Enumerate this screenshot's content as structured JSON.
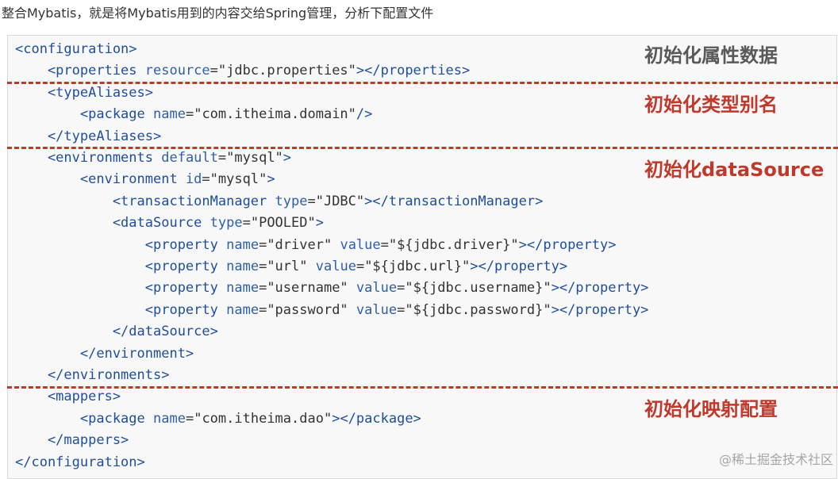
{
  "intro_text": "整合Mybatis，就是将Mybatis用到的内容交给Spring管理，分析下配置文件",
  "colors": {
    "tag": "#1f4e9c",
    "attr": "#2f5fa8",
    "value": "#333333",
    "label_gray": "#595959",
    "label_red": "#c0392b",
    "divider": "#c0392b"
  },
  "code_lines": [
    [
      {
        "t": "tag",
        "s": "<configuration>"
      }
    ],
    [
      {
        "t": "tag",
        "s": "    <properties "
      },
      {
        "t": "attr",
        "s": "resource"
      },
      {
        "t": "plain",
        "s": "="
      },
      {
        "t": "val",
        "s": "\"jdbc.properties\""
      },
      {
        "t": "tag",
        "s": "></properties>"
      }
    ],
    [
      {
        "t": "tag",
        "s": "    <typeAliases>"
      }
    ],
    [
      {
        "t": "tag",
        "s": "        <package "
      },
      {
        "t": "attr",
        "s": "name"
      },
      {
        "t": "plain",
        "s": "="
      },
      {
        "t": "val",
        "s": "\"com.itheima.domain\""
      },
      {
        "t": "tag",
        "s": "/>"
      }
    ],
    [
      {
        "t": "tag",
        "s": "    </typeAliases>"
      }
    ],
    [
      {
        "t": "tag",
        "s": "    <environments "
      },
      {
        "t": "attr",
        "s": "default"
      },
      {
        "t": "plain",
        "s": "="
      },
      {
        "t": "val",
        "s": "\"mysql\""
      },
      {
        "t": "tag",
        "s": ">"
      }
    ],
    [
      {
        "t": "tag",
        "s": "        <environment "
      },
      {
        "t": "attr",
        "s": "id"
      },
      {
        "t": "plain",
        "s": "="
      },
      {
        "t": "val",
        "s": "\"mysql\""
      },
      {
        "t": "tag",
        "s": ">"
      }
    ],
    [
      {
        "t": "tag",
        "s": "            <transactionManager "
      },
      {
        "t": "attr",
        "s": "type"
      },
      {
        "t": "plain",
        "s": "="
      },
      {
        "t": "val",
        "s": "\"JDBC\""
      },
      {
        "t": "tag",
        "s": "></transactionManager>"
      }
    ],
    [
      {
        "t": "tag",
        "s": "            <dataSource "
      },
      {
        "t": "attr",
        "s": "type"
      },
      {
        "t": "plain",
        "s": "="
      },
      {
        "t": "val",
        "s": "\"POOLED\""
      },
      {
        "t": "tag",
        "s": ">"
      }
    ],
    [
      {
        "t": "tag",
        "s": "                <property "
      },
      {
        "t": "attr",
        "s": "name"
      },
      {
        "t": "plain",
        "s": "="
      },
      {
        "t": "val",
        "s": "\"driver\""
      },
      {
        "t": "plain",
        "s": " "
      },
      {
        "t": "attr",
        "s": "value"
      },
      {
        "t": "plain",
        "s": "="
      },
      {
        "t": "val",
        "s": "\"${jdbc.driver}\""
      },
      {
        "t": "tag",
        "s": "></property>"
      }
    ],
    [
      {
        "t": "tag",
        "s": "                <property "
      },
      {
        "t": "attr",
        "s": "name"
      },
      {
        "t": "plain",
        "s": "="
      },
      {
        "t": "val",
        "s": "\"url\""
      },
      {
        "t": "plain",
        "s": " "
      },
      {
        "t": "attr",
        "s": "value"
      },
      {
        "t": "plain",
        "s": "="
      },
      {
        "t": "val",
        "s": "\"${jdbc.url}\""
      },
      {
        "t": "tag",
        "s": "></property>"
      }
    ],
    [
      {
        "t": "tag",
        "s": "                <property "
      },
      {
        "t": "attr",
        "s": "name"
      },
      {
        "t": "plain",
        "s": "="
      },
      {
        "t": "val",
        "s": "\"username\""
      },
      {
        "t": "plain",
        "s": " "
      },
      {
        "t": "attr",
        "s": "value"
      },
      {
        "t": "plain",
        "s": "="
      },
      {
        "t": "val",
        "s": "\"${jdbc.username}\""
      },
      {
        "t": "tag",
        "s": "></property>"
      }
    ],
    [
      {
        "t": "tag",
        "s": "                <property "
      },
      {
        "t": "attr",
        "s": "name"
      },
      {
        "t": "plain",
        "s": "="
      },
      {
        "t": "val",
        "s": "\"password\""
      },
      {
        "t": "plain",
        "s": " "
      },
      {
        "t": "attr",
        "s": "value"
      },
      {
        "t": "plain",
        "s": "="
      },
      {
        "t": "val",
        "s": "\"${jdbc.password}\""
      },
      {
        "t": "tag",
        "s": "></property>"
      }
    ],
    [
      {
        "t": "tag",
        "s": "            </dataSource>"
      }
    ],
    [
      {
        "t": "tag",
        "s": "        </environment>"
      }
    ],
    [
      {
        "t": "tag",
        "s": "    </environments>"
      }
    ],
    [
      {
        "t": "tag",
        "s": "    <mappers>"
      }
    ],
    [
      {
        "t": "tag",
        "s": "        <package "
      },
      {
        "t": "attr",
        "s": "name"
      },
      {
        "t": "plain",
        "s": "="
      },
      {
        "t": "val",
        "s": "\"com.itheima.dao\""
      },
      {
        "t": "tag",
        "s": "></package>"
      }
    ],
    [
      {
        "t": "tag",
        "s": "    </mappers>"
      }
    ],
    [
      {
        "t": "tag",
        "s": "</configuration>"
      }
    ]
  ],
  "section_labels": [
    {
      "text": "初始化属性数据",
      "color": "#595959"
    },
    {
      "text": "初始化类型别名",
      "color": "#c0392b"
    },
    {
      "text": "初始化dataSource",
      "color": "#c0392b"
    },
    {
      "text": "初始化映射配置",
      "color": "#c0392b"
    }
  ],
  "watermark": "@稀土掘金技术社区"
}
